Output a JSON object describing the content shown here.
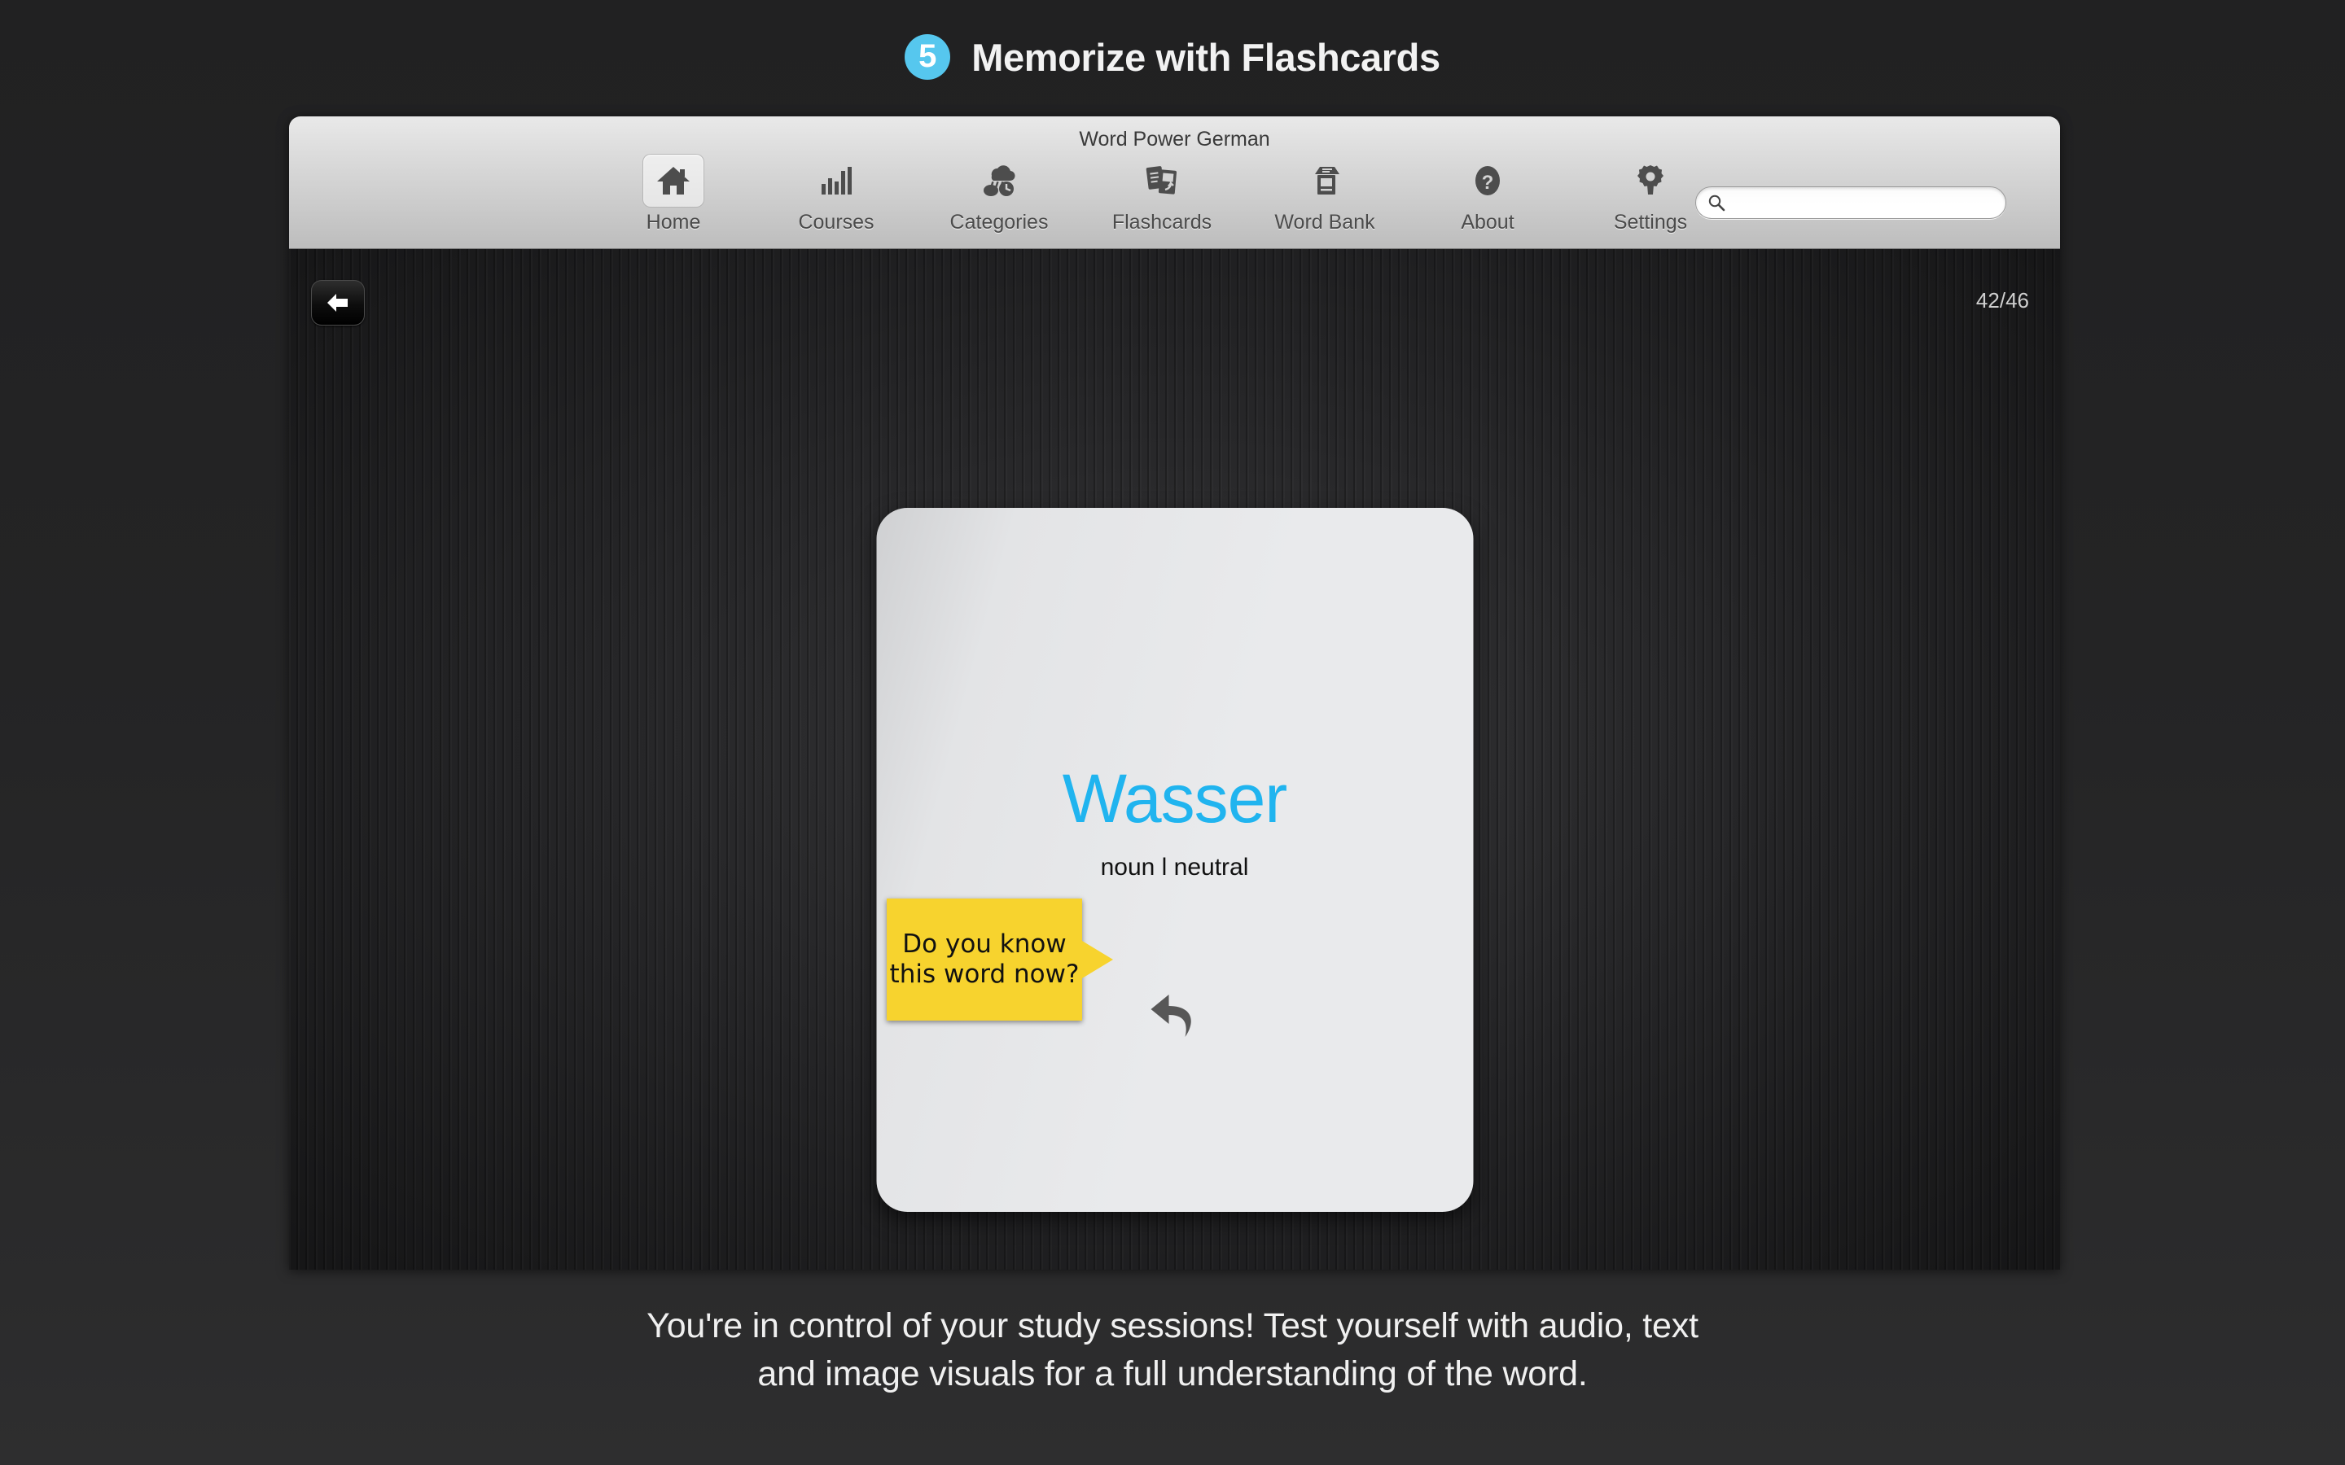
{
  "header": {
    "step_number": "5",
    "title": "Memorize with Flashcards",
    "badge_color": "#56c7ee"
  },
  "window": {
    "title": "Word Power German",
    "toolbar": {
      "items": [
        {
          "label": "Home",
          "icon": "home-icon",
          "selected": true
        },
        {
          "label": "Courses",
          "icon": "bar-chart-icon",
          "selected": false
        },
        {
          "label": "Categories",
          "icon": "cloud-rain-clock-icon",
          "selected": false
        },
        {
          "label": "Flashcards",
          "icon": "flashcards-icon",
          "selected": false
        },
        {
          "label": "Word Bank",
          "icon": "card-box-icon",
          "selected": false
        },
        {
          "label": "About",
          "icon": "question-mark-icon",
          "selected": false
        },
        {
          "label": "Settings",
          "icon": "gear-icon",
          "selected": false
        }
      ],
      "search": {
        "value": "",
        "placeholder": "",
        "icon": "search-icon"
      }
    }
  },
  "content": {
    "back_button_icon": "left-arrow-icon",
    "counter": "42/46",
    "flashcard": {
      "word": "Wasser",
      "word_color": "#20b4ef",
      "part_of_speech": "noun l neutral",
      "flip_icon": "undo-arrow-icon"
    },
    "callout": {
      "text": "Do you know this word now?",
      "color": "#f7d32e"
    }
  },
  "caption": {
    "line1": "You're in control of your study sessions! Test yourself with audio, text",
    "line2": "and image visuals for a full understanding of the word."
  }
}
